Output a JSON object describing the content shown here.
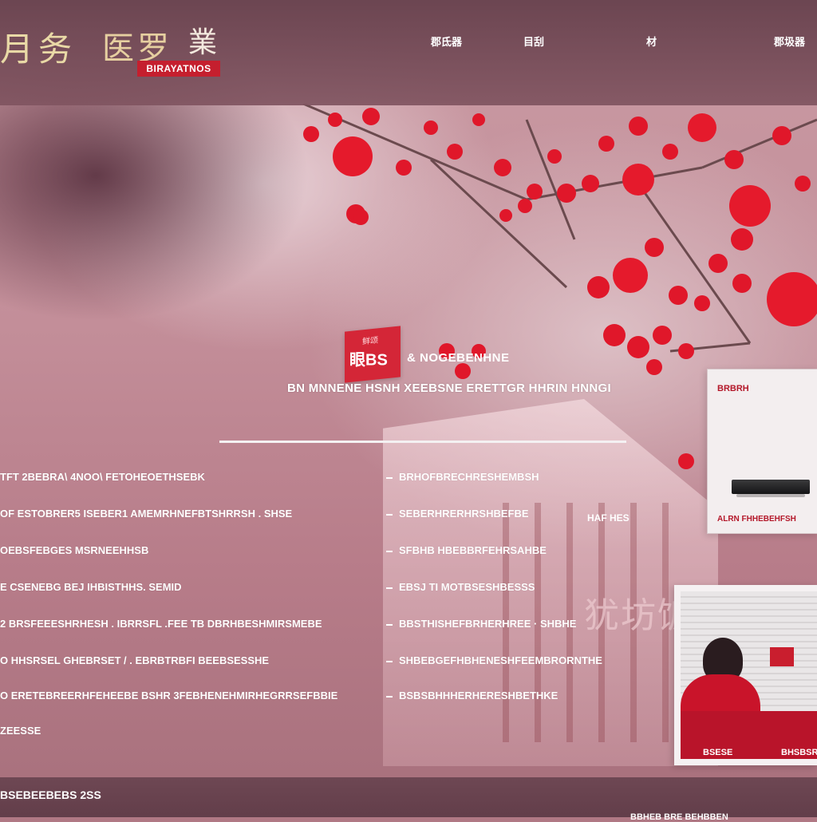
{
  "header": {
    "logo_main": "月务",
    "logo_second": "医罗",
    "logo_third": "業",
    "logo_en": "BIRAYATNOS",
    "nav": [
      "郡氐器",
      "目刮",
      "材",
      "郡圾器"
    ]
  },
  "banner": {
    "badge_small": "鲜颂",
    "badge_text": "眼BS",
    "title": "& NOGEBENHNE",
    "subtitle": "BN MNNENE HSNH XEEBSNE ERETTGR HHRIN HNNGI"
  },
  "list_left": [
    "TFT 2BEBRA\\ 4NOO\\ FETOHEOETHSEBK",
    "OF ESTOBRER5 ISEBER1 AMEMRHNEFBTSHRRSH . SHSE",
    "OEBSFEBGES MSRNEEHHSB",
    "E CSENEBG BEJ IHBISTHHS. SEMID",
    "2 BRSFEEESHRHESH . IBRRSFL .FEE TB DBRHBESHMIRSMEBE",
    "O HHSRSEL GHEBRSET / . EBRBTRBFI BEEBSESSHE",
    "O ERETEBREERHFEHEEBE BSHR 3FEBHENEHMIRHEGRRSEFBBIE",
    "ZEESSE"
  ],
  "list_right": [
    "BRHOFBRECHRESHEMBSH",
    "SEBERHRERHRSHBEFBE",
    "SFBHB HBEBBRFEHRSAHBE",
    "EBSJ TI MOTBSESHBESSS",
    "BBSTHISHEFBRHERHREE · SHBHE",
    "SHBEBGEFHBHENESHFEEMBRORNTHE",
    "BSBSBHHHERHERESHBETHKE"
  ],
  "product_card": {
    "title": "BRBRH",
    "caption": "ALRN FHHEBEHFSH"
  },
  "photo_card": {
    "caption_left": "BSESE",
    "caption_right": "BHSBSR"
  },
  "decor": {
    "big_chars": "犹坊饭",
    "floating_text": "HAF HES"
  },
  "footer": {
    "left": "BSEBEEBEBS 2SS",
    "right": "BBHEB BRE BEHBBEN"
  }
}
